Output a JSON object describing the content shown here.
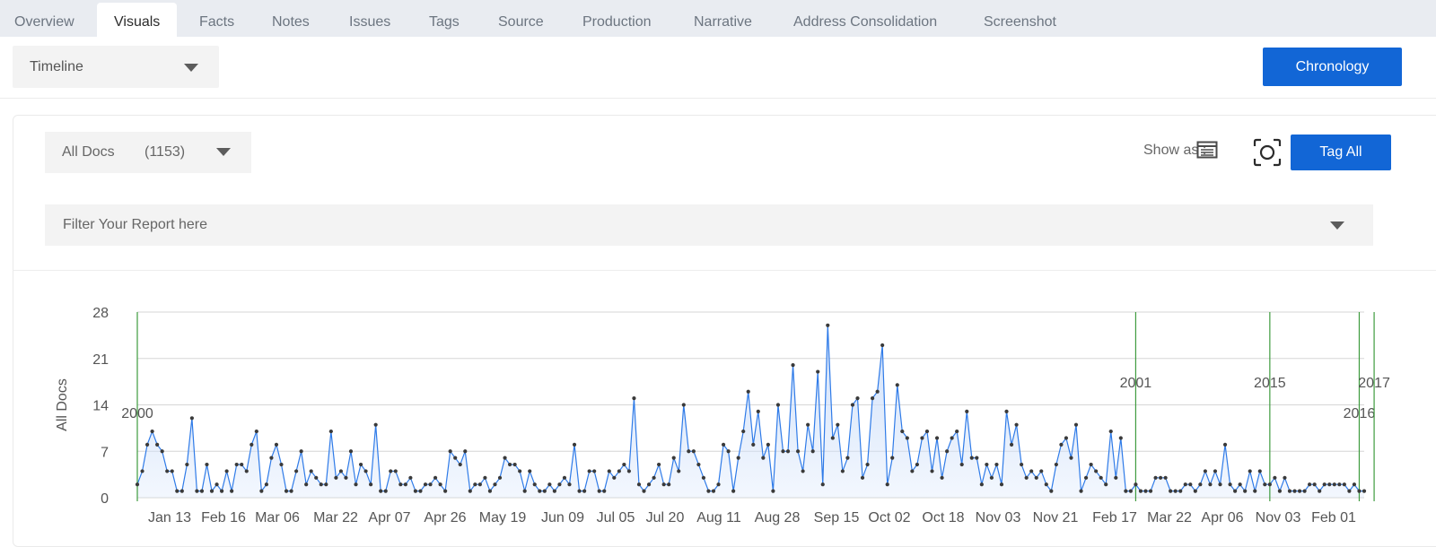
{
  "tabs": [
    {
      "label": "Overview",
      "active": false
    },
    {
      "label": "Visuals",
      "active": true
    },
    {
      "label": "Facts",
      "active": false
    },
    {
      "label": "Notes",
      "active": false
    },
    {
      "label": "Issues",
      "active": false
    },
    {
      "label": "Tags",
      "active": false
    },
    {
      "label": "Source",
      "active": false
    },
    {
      "label": "Production",
      "active": false
    },
    {
      "label": "Narrative",
      "active": false
    },
    {
      "label": "Address Consolidation",
      "active": false
    },
    {
      "label": "Screenshot",
      "active": false
    }
  ],
  "view_select": {
    "value": "Timeline"
  },
  "chronology_button": {
    "label": "Chronology"
  },
  "docs_select": {
    "value": "All Docs",
    "count": "(1153)"
  },
  "show_as": {
    "label": "Show as :",
    "icons": [
      "list-view-icon",
      "screenshot-icon"
    ]
  },
  "tag_all_button": {
    "label": "Tag All"
  },
  "filter": {
    "placeholder": "Filter Your Report here"
  },
  "colors": {
    "accent": "#1266d6",
    "line": "#2f7be8",
    "fill": "#cfe0fa",
    "year_marker": "#3e9b3e",
    "tab_bar": "#e9ecf1"
  },
  "chart_data": {
    "type": "area",
    "ylabel": "All Docs",
    "yticks": [
      0,
      7,
      14,
      21,
      28
    ],
    "ylim": [
      0,
      28
    ],
    "xticks": [
      "Jan 13",
      "Feb 16",
      "Mar 06",
      "Mar 22",
      "Apr 07",
      "Apr 26",
      "May 19",
      "Jun 09",
      "Jul 05",
      "Jul 20",
      "Aug 11",
      "Aug 28",
      "Sep 15",
      "Oct 02",
      "Oct 18",
      "Nov 03",
      "Nov 21",
      "Feb 17",
      "Mar 22",
      "Apr 06",
      "Nov 03",
      "Feb 01"
    ],
    "year_markers": [
      {
        "label": "2000",
        "index": 0
      },
      {
        "label": "2001",
        "index": 201
      },
      {
        "label": "2015",
        "index": 228
      },
      {
        "label": "2016",
        "index": 246
      },
      {
        "label": "2017",
        "index": 249
      }
    ],
    "values": [
      2,
      4,
      8,
      10,
      8,
      7,
      4,
      4,
      1,
      1,
      5,
      12,
      1,
      1,
      5,
      1,
      2,
      1,
      4,
      1,
      5,
      5,
      4,
      8,
      10,
      1,
      2,
      6,
      8,
      5,
      1,
      1,
      4,
      7,
      2,
      4,
      3,
      2,
      2,
      10,
      3,
      4,
      3,
      7,
      2,
      5,
      4,
      2,
      11,
      1,
      1,
      4,
      4,
      2,
      2,
      3,
      1,
      1,
      2,
      2,
      3,
      2,
      1,
      7,
      6,
      5,
      7,
      1,
      2,
      2,
      3,
      1,
      2,
      3,
      6,
      5,
      5,
      4,
      1,
      4,
      2,
      1,
      1,
      2,
      1,
      2,
      3,
      2,
      8,
      1,
      1,
      4,
      4,
      1,
      1,
      4,
      3,
      4,
      5,
      4,
      15,
      2,
      1,
      2,
      3,
      5,
      2,
      2,
      6,
      4,
      14,
      7,
      7,
      5,
      3,
      1,
      1,
      2,
      8,
      7,
      1,
      6,
      10,
      16,
      8,
      13,
      6,
      8,
      1,
      14,
      7,
      7,
      20,
      7,
      4,
      11,
      7,
      19,
      2,
      26,
      9,
      11,
      4,
      6,
      14,
      15,
      3,
      5,
      15,
      16,
      23,
      2,
      6,
      17,
      10,
      9,
      4,
      5,
      9,
      10,
      4,
      9,
      3,
      7,
      9,
      10,
      5,
      13,
      6,
      6,
      2,
      5,
      3,
      5,
      2,
      13,
      8,
      11,
      5,
      3,
      4,
      3,
      4,
      2,
      1,
      5,
      8,
      9,
      6,
      11,
      1,
      3,
      5,
      4,
      3,
      2,
      10,
      3,
      9,
      1,
      1,
      2,
      1,
      1,
      1,
      3,
      3,
      3,
      1,
      1,
      1,
      2,
      2,
      1,
      2,
      4,
      2,
      4,
      2,
      8,
      2,
      1,
      2,
      1,
      4,
      1,
      4,
      2,
      2,
      3,
      1,
      3,
      1,
      1,
      1,
      1,
      2,
      2,
      1,
      2,
      2,
      2,
      2,
      2,
      1,
      2,
      1,
      1
    ]
  }
}
